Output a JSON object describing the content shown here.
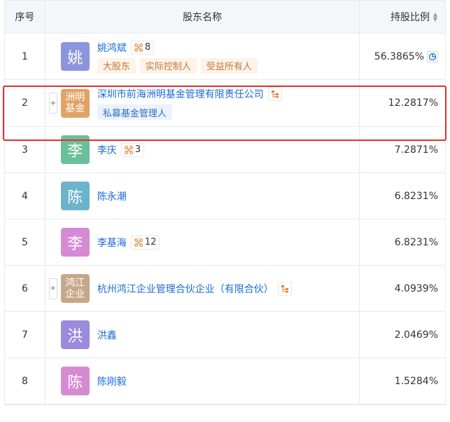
{
  "header": {
    "index_label": "序号",
    "name_label": "股东名称",
    "pct_label": "持股比例"
  },
  "colors": {
    "link": "#1a6bd6",
    "highlight_border": "#e0302d",
    "avatar_yao": "#8c95db",
    "avatar_fund": "#e0a365",
    "avatar_li": "#6cc099",
    "avatar_chen": "#6db3cc",
    "avatar_li2": "#d58bd3",
    "avatar_hongjiang": "#c7a78a",
    "avatar_hong": "#9a8bdc",
    "avatar_chen2": "#d58bd3"
  },
  "rows": [
    {
      "index": "1",
      "avatar": "姚",
      "name": "姚鸿斌",
      "rel_count": "8",
      "tags": [
        "大股东",
        "实际控制人",
        "受益所有人"
      ],
      "pct": "56.3865%"
    },
    {
      "index": "2",
      "avatar": "洲明基金",
      "name": "深圳市前海洲明基金管理有限责任公司",
      "tags": [
        "私募基金管理人"
      ],
      "pct": "12.2817%"
    },
    {
      "index": "3",
      "avatar": "李",
      "name": "李庆",
      "rel_count": "3",
      "pct": "7.2871%"
    },
    {
      "index": "4",
      "avatar": "陈",
      "name": "陈永潮",
      "pct": "6.8231%"
    },
    {
      "index": "5",
      "avatar": "李",
      "name": "李基海",
      "rel_count": "12",
      "pct": "6.8231%"
    },
    {
      "index": "6",
      "avatar": "鸿江企业",
      "name": "杭州鸿江企业管理合伙企业（有限合伙）",
      "pct": "4.0939%"
    },
    {
      "index": "7",
      "avatar": "洪",
      "name": "洪鑫",
      "pct": "2.0469%"
    },
    {
      "index": "8",
      "avatar": "陈",
      "name": "陈刚毅",
      "pct": "1.5284%"
    }
  ]
}
